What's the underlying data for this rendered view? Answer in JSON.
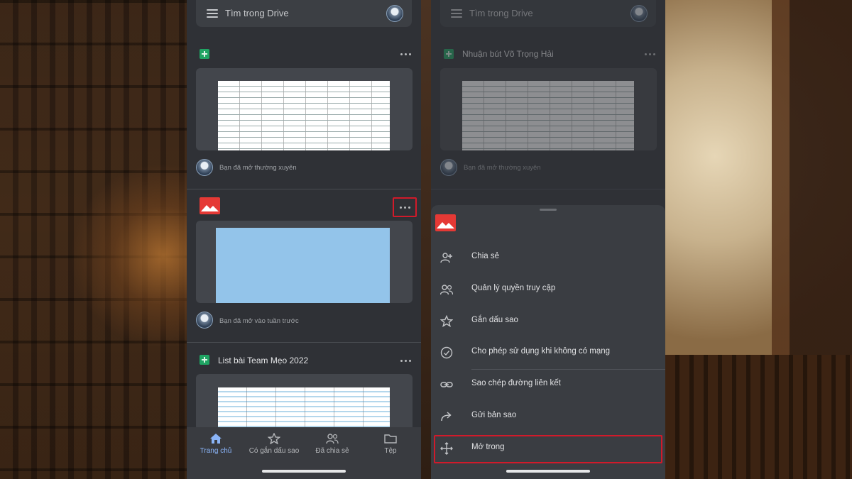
{
  "search": {
    "placeholder": "Tìm trong Drive"
  },
  "left_phone": {
    "cards": [
      {
        "title": "",
        "type": "sheet",
        "activity": "Bạn đã mở thường xuyên"
      },
      {
        "title": "",
        "type": "image",
        "activity": "Bạn đã mở vào tuần trước"
      },
      {
        "title": "List bài Team Mẹo 2022",
        "type": "sheet",
        "activity": ""
      }
    ]
  },
  "right_phone": {
    "cards": [
      {
        "title": "Nhuận bút Võ Trọng Hải",
        "type": "sheet",
        "activity": "Bạn đã mở thường xuyên"
      }
    ]
  },
  "bottom_nav": [
    {
      "label": "Trang chủ",
      "icon": "home-icon",
      "active": true
    },
    {
      "label": "Có gắn dấu sao",
      "icon": "star-icon",
      "active": false
    },
    {
      "label": "Đã chia sẻ",
      "icon": "people-icon",
      "active": false
    },
    {
      "label": "Tệp",
      "icon": "folder-icon",
      "active": false
    }
  ],
  "menu": {
    "items": [
      {
        "label": "Chia sẻ",
        "icon": "person-add-icon"
      },
      {
        "label": "Quản lý quyền truy cập",
        "icon": "manage-access-icon"
      },
      {
        "label": "Gắn dấu sao",
        "icon": "star-outline-icon"
      },
      {
        "label": "Cho phép sử dụng khi không có mạng",
        "icon": "offline-check-icon"
      },
      {
        "label": "Sao chép đường liên kết",
        "icon": "link-icon"
      },
      {
        "label": "Gửi bản sao",
        "icon": "send-copy-icon"
      },
      {
        "label": "Mở trong",
        "icon": "open-in-icon"
      }
    ],
    "highlighted": "Mở trong"
  },
  "colors": {
    "app_bg": "#2f3136",
    "accent": "#8ab4f8",
    "highlight_border": "#d11a2a",
    "sheets_green": "#1fa463",
    "image_red": "#e53935"
  }
}
